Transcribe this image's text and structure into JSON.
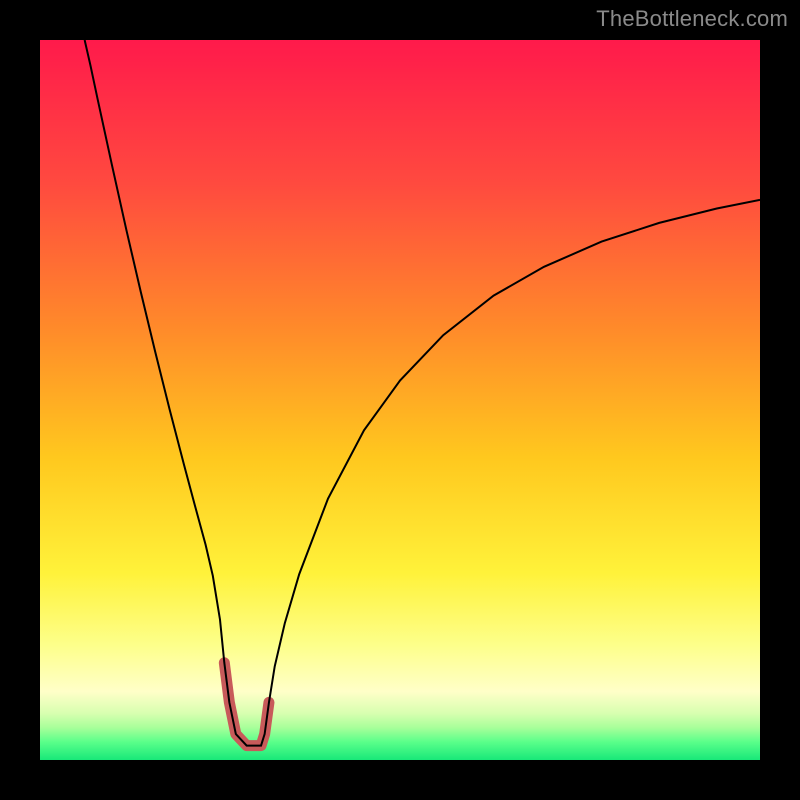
{
  "watermark": "TheBottleneck.com",
  "chart_data": {
    "type": "line",
    "title": "",
    "xlabel": "",
    "ylabel": "",
    "xlim": [
      0,
      100
    ],
    "ylim": [
      0,
      100
    ],
    "background_gradient_stops": [
      {
        "offset": 0.0,
        "color": "#ff1a4b"
      },
      {
        "offset": 0.2,
        "color": "#ff4a3f"
      },
      {
        "offset": 0.4,
        "color": "#ff8a2a"
      },
      {
        "offset": 0.58,
        "color": "#ffc81e"
      },
      {
        "offset": 0.74,
        "color": "#fff23a"
      },
      {
        "offset": 0.84,
        "color": "#fdff8a"
      },
      {
        "offset": 0.905,
        "color": "#ffffc8"
      },
      {
        "offset": 0.935,
        "color": "#d8ffb0"
      },
      {
        "offset": 0.955,
        "color": "#a8ff9a"
      },
      {
        "offset": 0.975,
        "color": "#5aff8a"
      },
      {
        "offset": 1.0,
        "color": "#18e879"
      }
    ],
    "series": [
      {
        "name": "bottleneck-curve",
        "color": "#000000",
        "width": 2,
        "x": [
          6.2,
          7,
          8,
          9,
          10,
          12,
          14,
          16,
          18,
          20,
          21.5,
          23,
          24,
          25,
          25.6,
          26.3,
          27.2,
          28.7,
          30.7,
          31.2,
          31.8,
          32.6,
          34,
          36,
          40,
          45,
          50,
          56,
          63,
          70,
          78,
          86,
          94,
          100
        ],
        "y": [
          100,
          96.5,
          91.8,
          87.2,
          82.6,
          73.6,
          65.0,
          56.7,
          48.7,
          41.0,
          35.4,
          29.9,
          25.6,
          19.5,
          13.5,
          8.0,
          3.6,
          2.0,
          2.0,
          3.6,
          8.0,
          13.0,
          19.0,
          25.8,
          36.3,
          45.8,
          52.7,
          59.0,
          64.5,
          68.5,
          72.0,
          74.6,
          76.6,
          77.8
        ]
      },
      {
        "name": "valley-highlight",
        "color": "#c85a5a",
        "width": 11,
        "linecap": "round",
        "x": [
          25.6,
          26.3,
          27.2,
          28.7,
          30.7,
          31.2,
          31.8
        ],
        "y": [
          13.5,
          8.0,
          3.6,
          2.0,
          2.0,
          3.6,
          8.0
        ]
      }
    ]
  }
}
